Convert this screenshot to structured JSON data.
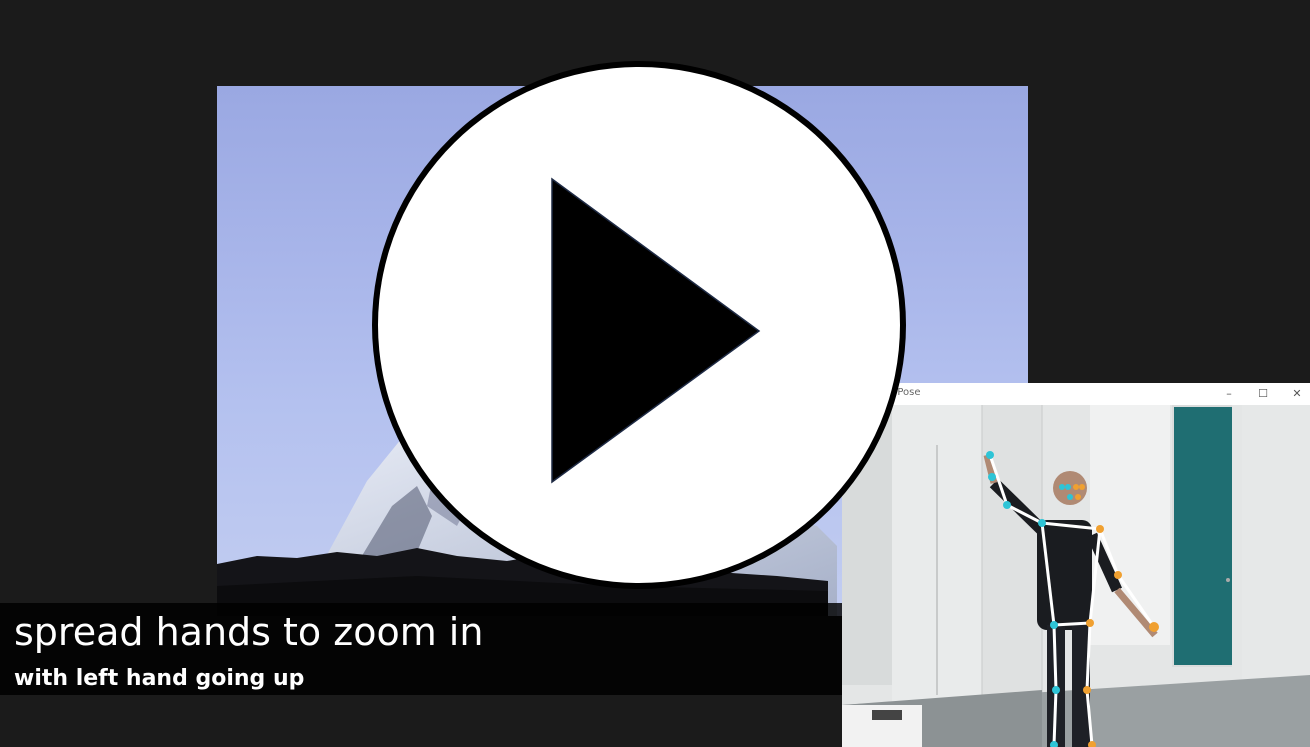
{
  "caption": {
    "main": "spread hands to zoom in",
    "sub": "with left hand going up"
  },
  "pose_window": {
    "title": "e Pose",
    "controls": {
      "minimize": "–",
      "maximize": "☐",
      "close": "✕"
    }
  },
  "colors": {
    "background": "#1b1b1b",
    "sky": "#a9b6ea",
    "pose_left": "#2ec4d6",
    "pose_right": "#f0a030",
    "skeleton": "#ffffff",
    "play_button": "#ffffff"
  },
  "icons": {
    "play": "play-icon"
  }
}
